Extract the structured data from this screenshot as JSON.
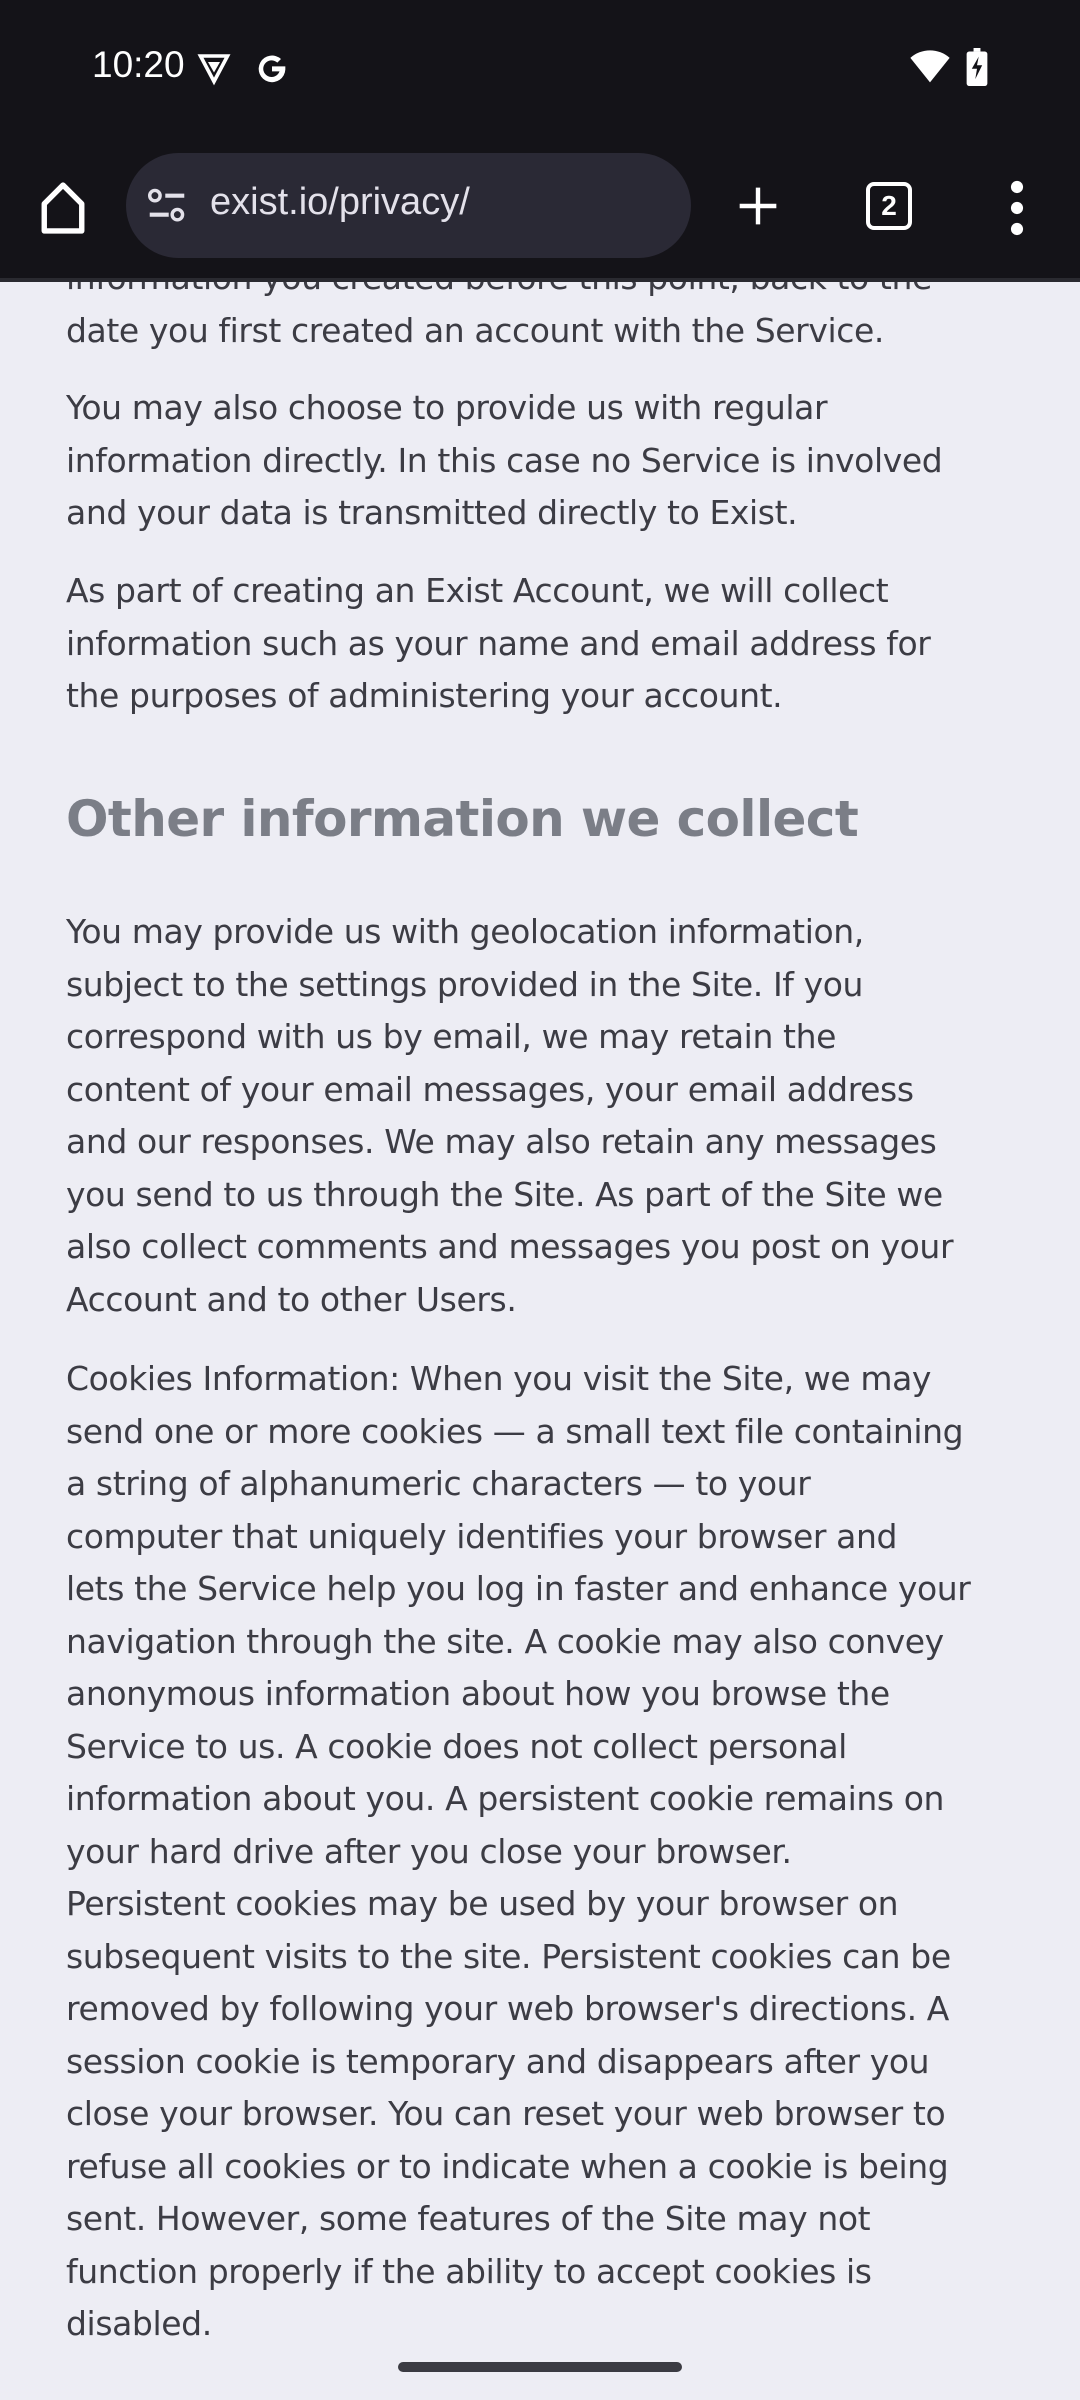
{
  "status_bar": {
    "time": "10:20",
    "icons": [
      "vpn-shield-icon",
      "google-icon",
      "wifi-icon",
      "battery-charging-icon"
    ]
  },
  "browser": {
    "url": "exist.io/privacy/",
    "tab_count": "2",
    "icons": [
      "home-icon",
      "site-settings-icon",
      "new-tab-icon",
      "tab-switcher-icon",
      "more-menu-icon"
    ]
  },
  "colors": {
    "background": "#ededf4",
    "text": "#3c3c44",
    "heading": "#7b7e87",
    "chrome": "#141318"
  },
  "content": {
    "intro_paragraphs": [
      {
        "lines": [
          "information you created before this point, back to the",
          "date you first created an account with the Service."
        ]
      },
      {
        "lines": [
          "You may also choose to provide us with regular",
          "information directly. In this case no Service is involved",
          "and your data is transmitted directly to Exist."
        ]
      },
      {
        "lines": [
          "As part of creating an Exist Account, we will collect",
          "information such as your name and email address for",
          "the purposes of administering your account."
        ]
      }
    ],
    "heading": "Other information we collect",
    "paragraphs": [
      {
        "lines": [
          "You may provide us with geolocation information,",
          "subject to the settings provided in the Site. If you",
          "correspond with us by email, we may retain the",
          "content of your email messages, your email address",
          "and our responses. We may also retain any messages",
          "you send to us through the Site. As part of the Site we",
          "also collect comments and messages you post on your",
          "Account and to other Users."
        ]
      },
      {
        "lines": [
          "Cookies Information: When you visit the Site, we may",
          "send one or more cookies — a small text file containing",
          "a string of alphanumeric characters — to your",
          "computer that uniquely identifies your browser and",
          "lets the Service help you log in faster and enhance your",
          "navigation through the site. A cookie may also convey",
          "anonymous information about how you browse the",
          "Service to us. A cookie does not collect personal",
          "information about you. A persistent cookie remains on",
          "your hard drive after you close your browser.",
          "Persistent cookies may be used by your browser on",
          "subsequent visits to the site. Persistent cookies can be",
          "removed by following your web browser's directions. A",
          "session cookie is temporary and disappears after you",
          "close your browser. You can reset your web browser to",
          "refuse all cookies or to indicate when a cookie is being",
          "sent. However, some features of the Site may not",
          "function properly if the ability to accept cookies is",
          "disabled."
        ]
      }
    ]
  }
}
